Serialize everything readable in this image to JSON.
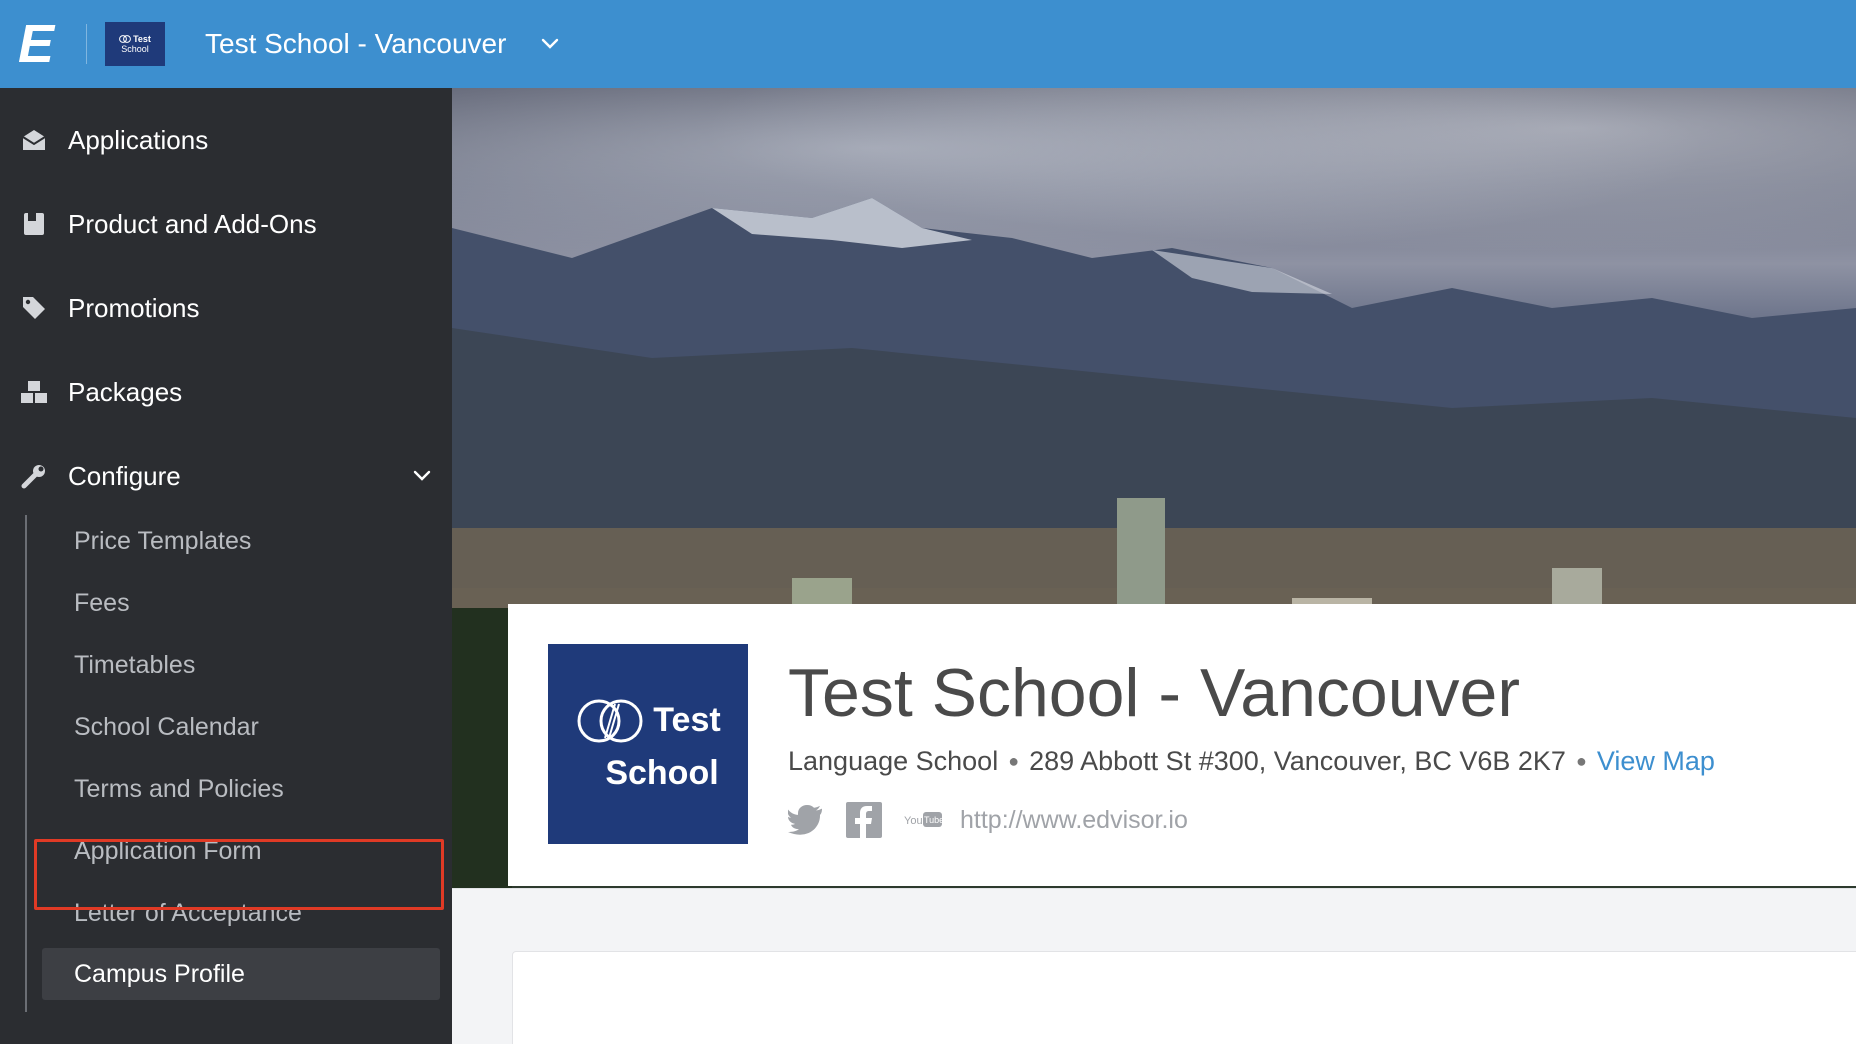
{
  "topbar": {
    "brand_letter": "E",
    "thumb_line1": "Test",
    "thumb_line2": "School",
    "school_name": "Test School - Vancouver"
  },
  "sidebar": {
    "items": [
      {
        "label": "Applications",
        "icon": "applications-icon"
      },
      {
        "label": "Product and Add-Ons",
        "icon": "product-icon"
      },
      {
        "label": "Promotions",
        "icon": "tag-icon"
      },
      {
        "label": "Packages",
        "icon": "packages-icon"
      },
      {
        "label": "Configure",
        "icon": "wrench-icon"
      }
    ],
    "configure_subitems": [
      {
        "label": "Price Templates"
      },
      {
        "label": "Fees"
      },
      {
        "label": "Timetables"
      },
      {
        "label": "School Calendar"
      },
      {
        "label": "Terms and Policies"
      },
      {
        "label": "Application Form"
      },
      {
        "label": "Letter of Acceptance"
      },
      {
        "label": "Campus Profile"
      }
    ],
    "active_subitem": "Campus Profile",
    "highlighted_subitem": "Terms and Policies"
  },
  "profile": {
    "logo_line1": "Test",
    "logo_line2": "School",
    "title": "Test School - Vancouver",
    "type": "Language School",
    "address": "289 Abbott St #300, Vancouver, BC V6B 2K7",
    "map_link": "View Map",
    "website": "http://www.edvisor.io",
    "youtube_label": "You Tube"
  },
  "colors": {
    "topbar": "#3d8fcf",
    "sidebar": "#2b2d31",
    "highlight": "#e03a25",
    "logo_bg": "#1f3a7a",
    "link": "#3d8fcf"
  }
}
